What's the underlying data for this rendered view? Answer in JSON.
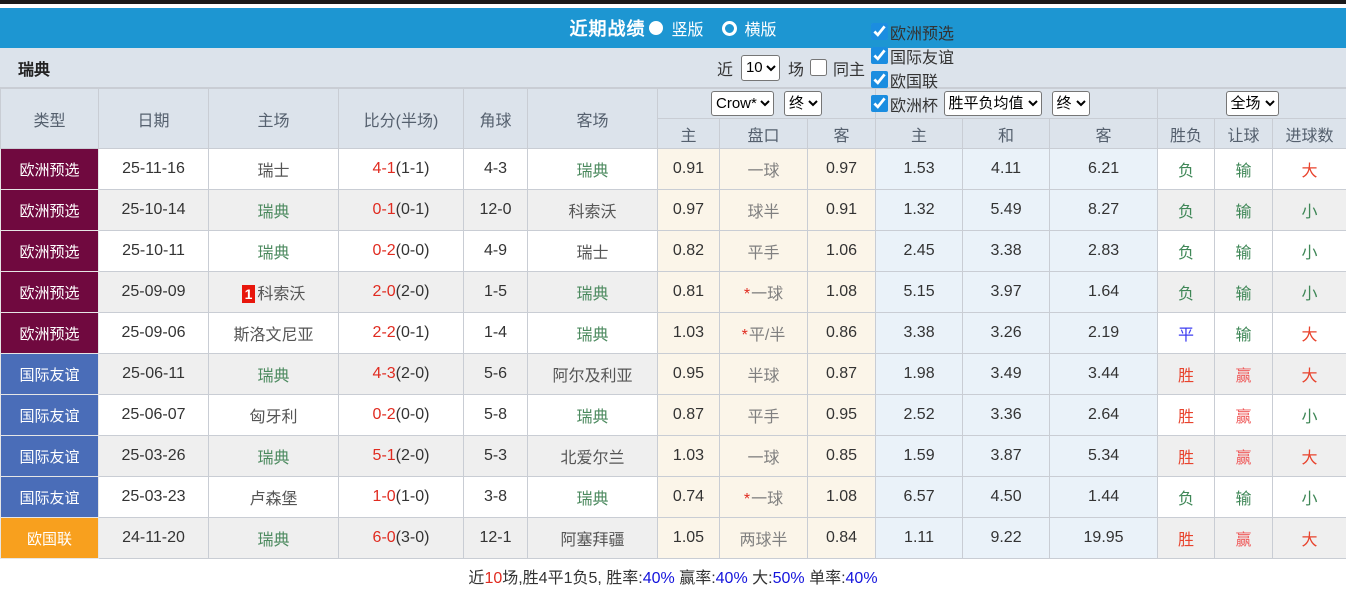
{
  "topbar": {
    "title": "近期战绩",
    "radio_vertical": "竖版",
    "radio_horizontal": "横版"
  },
  "filters": {
    "team": "瑞典",
    "recent_label": "近",
    "recent_value": "10",
    "games_label": "场",
    "same_home_label": "同主",
    "same_home_checked": false,
    "competitions": [
      {
        "label": "欧洲预选",
        "checked": true
      },
      {
        "label": "国际友谊",
        "checked": true
      },
      {
        "label": "欧国联",
        "checked": true
      },
      {
        "label": "欧洲杯",
        "checked": true
      }
    ]
  },
  "table": {
    "headers": {
      "type": "类型",
      "date": "日期",
      "home": "主场",
      "score": "比分(半场)",
      "corner": "角球",
      "away": "客场",
      "handicap_company_select": "Crow*",
      "handicap_time_select": "终",
      "odds_company_select": "胜平负均值",
      "odds_time_select": "终",
      "scope_select": "全场",
      "sub_handicap_home": "主",
      "sub_handicap_line": "盘口",
      "sub_handicap_away": "客",
      "sub_odds_home": "主",
      "sub_odds_draw": "和",
      "sub_odds_away": "客",
      "result": "胜负",
      "handicap_result": "让球",
      "goals_result": "进球数"
    },
    "rows": [
      {
        "type": "欧洲预选",
        "type_color": "#70093f",
        "date": "25-11-16",
        "home": "瑞士",
        "home_is_team": false,
        "home_badge": "",
        "score": "4-1",
        "half": "(1-1)",
        "corner": "4-3",
        "away": "瑞典",
        "away_is_team": true,
        "h_home": "0.91",
        "star": false,
        "handicap": "一球",
        "h_away": "0.97",
        "o_home": "1.53",
        "o_draw": "4.11",
        "o_away": "6.21",
        "res": "负",
        "let": "输",
        "goal": "大"
      },
      {
        "type": "欧洲预选",
        "type_color": "#70093f",
        "date": "25-10-14",
        "home": "瑞典",
        "home_is_team": true,
        "home_badge": "",
        "score": "0-1",
        "half": "(0-1)",
        "corner": "12-0",
        "away": "科索沃",
        "away_is_team": false,
        "h_home": "0.97",
        "star": false,
        "handicap": "球半",
        "h_away": "0.91",
        "o_home": "1.32",
        "o_draw": "5.49",
        "o_away": "8.27",
        "res": "负",
        "let": "输",
        "goal": "小"
      },
      {
        "type": "欧洲预选",
        "type_color": "#70093f",
        "date": "25-10-11",
        "home": "瑞典",
        "home_is_team": true,
        "home_badge": "",
        "score": "0-2",
        "half": "(0-0)",
        "corner": "4-9",
        "away": "瑞士",
        "away_is_team": false,
        "h_home": "0.82",
        "star": false,
        "handicap": "平手",
        "h_away": "1.06",
        "o_home": "2.45",
        "o_draw": "3.38",
        "o_away": "2.83",
        "res": "负",
        "let": "输",
        "goal": "小"
      },
      {
        "type": "欧洲预选",
        "type_color": "#70093f",
        "date": "25-09-09",
        "home": "科索沃",
        "home_is_team": false,
        "home_badge": "1",
        "score": "2-0",
        "half": "(2-0)",
        "corner": "1-5",
        "away": "瑞典",
        "away_is_team": true,
        "h_home": "0.81",
        "star": true,
        "handicap": "一球",
        "h_away": "1.08",
        "o_home": "5.15",
        "o_draw": "3.97",
        "o_away": "1.64",
        "res": "负",
        "let": "输",
        "goal": "小"
      },
      {
        "type": "欧洲预选",
        "type_color": "#70093f",
        "date": "25-09-06",
        "home": "斯洛文尼亚",
        "home_is_team": false,
        "home_badge": "",
        "score": "2-2",
        "half": "(0-1)",
        "corner": "1-4",
        "away": "瑞典",
        "away_is_team": true,
        "h_home": "1.03",
        "star": true,
        "handicap": "平/半",
        "h_away": "0.86",
        "o_home": "3.38",
        "o_draw": "3.26",
        "o_away": "2.19",
        "res": "平",
        "let": "输",
        "goal": "大"
      },
      {
        "type": "国际友谊",
        "type_color": "#4a6db8",
        "date": "25-06-11",
        "home": "瑞典",
        "home_is_team": true,
        "home_badge": "",
        "score": "4-3",
        "half": "(2-0)",
        "corner": "5-6",
        "away": "阿尔及利亚",
        "away_is_team": false,
        "h_home": "0.95",
        "star": false,
        "handicap": "半球",
        "h_away": "0.87",
        "o_home": "1.98",
        "o_draw": "3.49",
        "o_away": "3.44",
        "res": "胜",
        "let": "赢",
        "goal": "大"
      },
      {
        "type": "国际友谊",
        "type_color": "#4a6db8",
        "date": "25-06-07",
        "home": "匈牙利",
        "home_is_team": false,
        "home_badge": "",
        "score": "0-2",
        "half": "(0-0)",
        "corner": "5-8",
        "away": "瑞典",
        "away_is_team": true,
        "h_home": "0.87",
        "star": false,
        "handicap": "平手",
        "h_away": "0.95",
        "o_home": "2.52",
        "o_draw": "3.36",
        "o_away": "2.64",
        "res": "胜",
        "let": "赢",
        "goal": "小"
      },
      {
        "type": "国际友谊",
        "type_color": "#4a6db8",
        "date": "25-03-26",
        "home": "瑞典",
        "home_is_team": true,
        "home_badge": "",
        "score": "5-1",
        "half": "(2-0)",
        "corner": "5-3",
        "away": "北爱尔兰",
        "away_is_team": false,
        "h_home": "1.03",
        "star": false,
        "handicap": "一球",
        "h_away": "0.85",
        "o_home": "1.59",
        "o_draw": "3.87",
        "o_away": "5.34",
        "res": "胜",
        "let": "赢",
        "goal": "大"
      },
      {
        "type": "国际友谊",
        "type_color": "#4a6db8",
        "date": "25-03-23",
        "home": "卢森堡",
        "home_is_team": false,
        "home_badge": "",
        "score": "1-0",
        "half": "(1-0)",
        "corner": "3-8",
        "away": "瑞典",
        "away_is_team": true,
        "h_home": "0.74",
        "star": true,
        "handicap": "一球",
        "h_away": "1.08",
        "o_home": "6.57",
        "o_draw": "4.50",
        "o_away": "1.44",
        "res": "负",
        "let": "输",
        "goal": "小"
      },
      {
        "type": "欧国联",
        "type_color": "#f8a01e",
        "date": "24-11-20",
        "home": "瑞典",
        "home_is_team": true,
        "home_badge": "",
        "score": "6-0",
        "half": "(3-0)",
        "corner": "12-1",
        "away": "阿塞拜疆",
        "away_is_team": false,
        "h_home": "1.05",
        "star": false,
        "handicap": "两球半",
        "h_away": "0.84",
        "o_home": "1.11",
        "o_draw": "9.22",
        "o_away": "19.95",
        "res": "胜",
        "let": "赢",
        "goal": "大"
      }
    ]
  },
  "colors": {
    "win": "#e8432d",
    "draw": "#3c3cf0",
    "lose": "#3f8757",
    "cover": "#ef5d5d",
    "not_cover": "#3f8757",
    "over": "#e8432d",
    "under": "#3f8757",
    "team_highlight": "#4c8a5f",
    "score_red": "#e02b20",
    "topbar_blue": "#1d96d2"
  },
  "summary": {
    "segments": [
      {
        "text": "近",
        "color": "#333333"
      },
      {
        "text": "10",
        "color": "#e02b20"
      },
      {
        "text": "场,胜4平1负5, 胜率:",
        "color": "#333333"
      },
      {
        "text": "40%",
        "color": "#1414dc"
      },
      {
        "text": " 赢率:",
        "color": "#333333"
      },
      {
        "text": "40%",
        "color": "#1414dc"
      },
      {
        "text": " 大:",
        "color": "#333333"
      },
      {
        "text": "50%",
        "color": "#1414dc"
      },
      {
        "text": " 单率:",
        "color": "#333333"
      },
      {
        "text": "40%",
        "color": "#1414dc"
      }
    ]
  }
}
